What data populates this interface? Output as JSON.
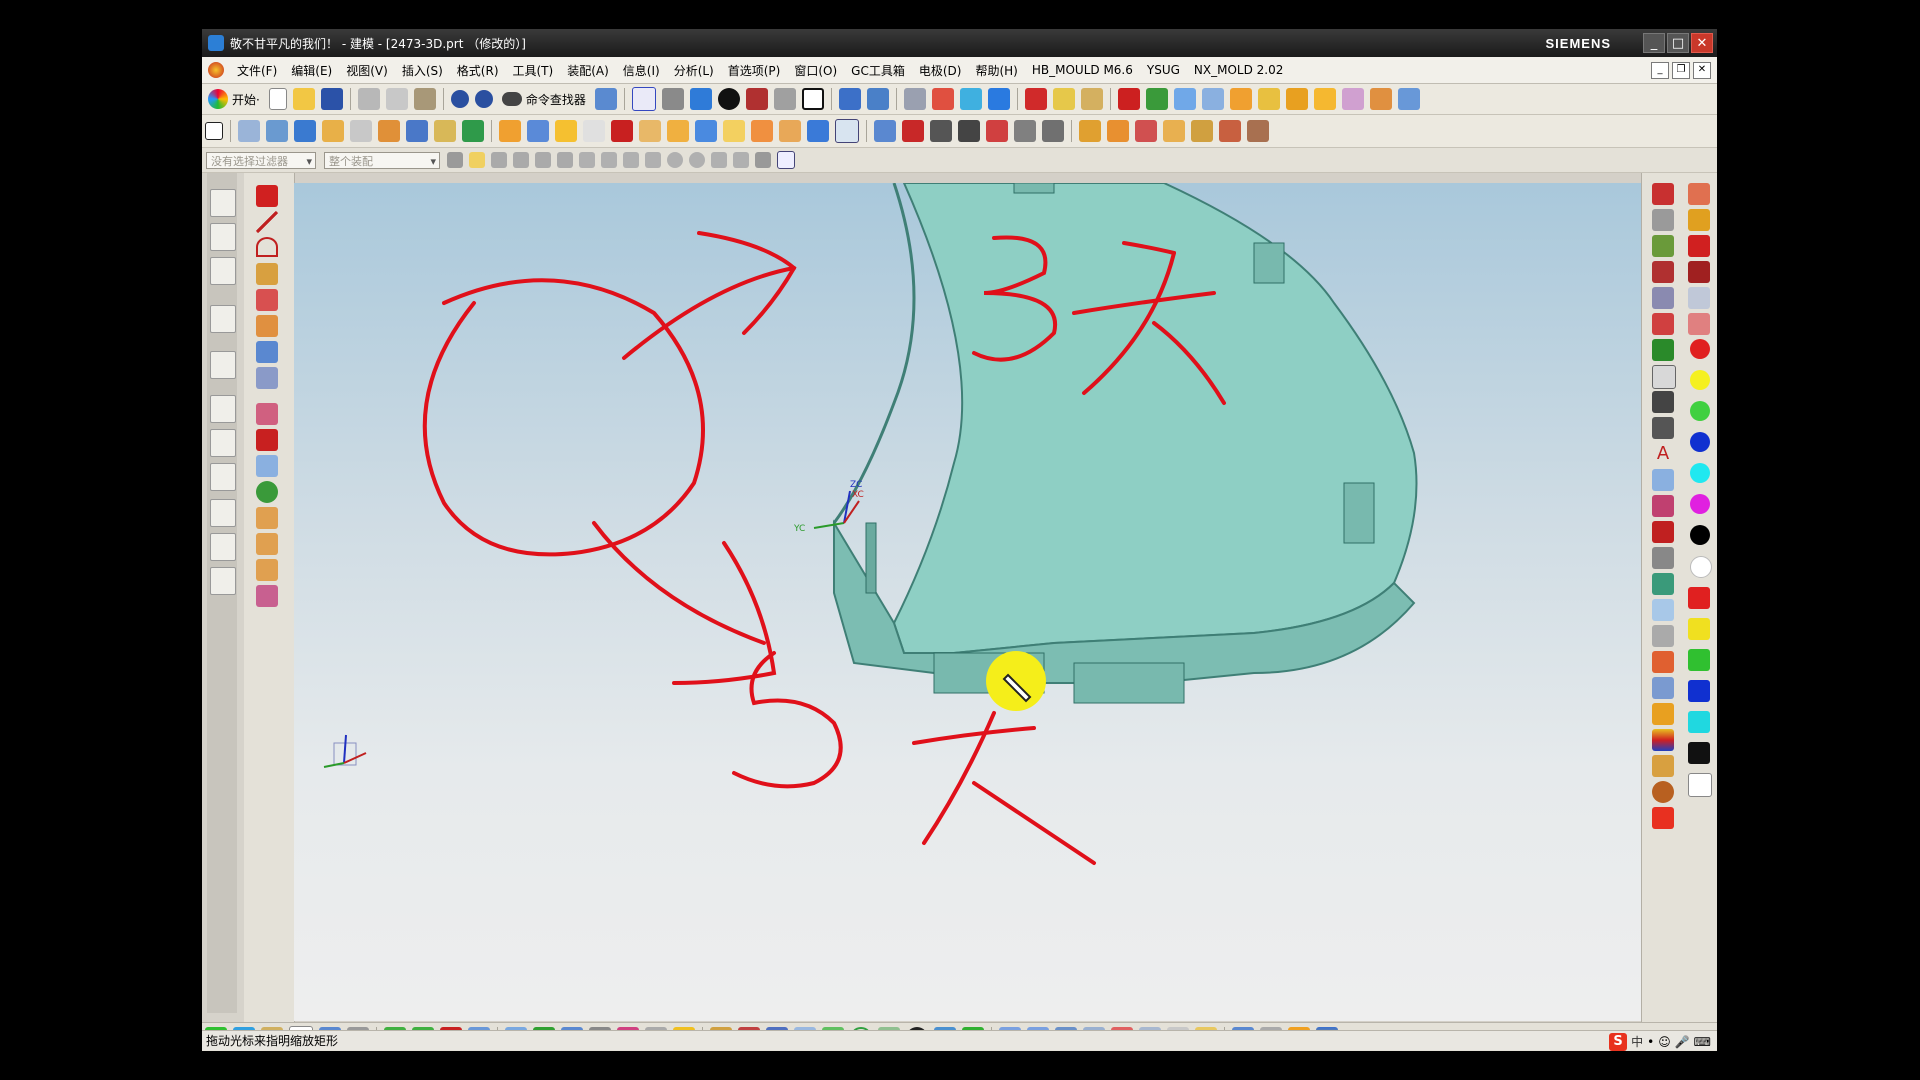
{
  "window": {
    "title": "敬不甘平凡的我们！ - 建模 - [2473-3D.prt （修改的）]",
    "brand": "SIEMENS",
    "controls": [
      "_",
      "□",
      "✕"
    ]
  },
  "menubar": {
    "items": [
      "文件(F)",
      "编辑(E)",
      "视图(V)",
      "插入(S)",
      "格式(R)",
      "工具(T)",
      "装配(A)",
      "信息(I)",
      "分析(L)",
      "首选项(P)",
      "窗口(O)",
      "GC工具箱",
      "电极(D)",
      "帮助(H)",
      "HB_MOULD M6.6",
      "YSUG",
      "NX_MOLD 2.02"
    ]
  },
  "toolbar": {
    "start_label": "开始·",
    "command_finder_label": "命令查找器"
  },
  "selection_bar": {
    "filter_value": "没有选择过滤器",
    "scope_value": "整个装配"
  },
  "annotations": {
    "top_right_text": "3 大",
    "bottom_text": "5 大"
  },
  "triad": {
    "zc": "ZC",
    "xc": "XC",
    "yc": "YC"
  },
  "status": {
    "message": "拖动光标来指明缩放矩形",
    "ime_label": "中"
  },
  "colors": {
    "model": "#8ecfc4",
    "annotation": "#e0101a",
    "cursor_highlight": "#f5ee1a"
  },
  "palette": [
    "#e02020",
    "#f5f020",
    "#40d040",
    "#1030d0",
    "#20e8f0",
    "#e020e0",
    "#000000",
    "#ffffff"
  ]
}
